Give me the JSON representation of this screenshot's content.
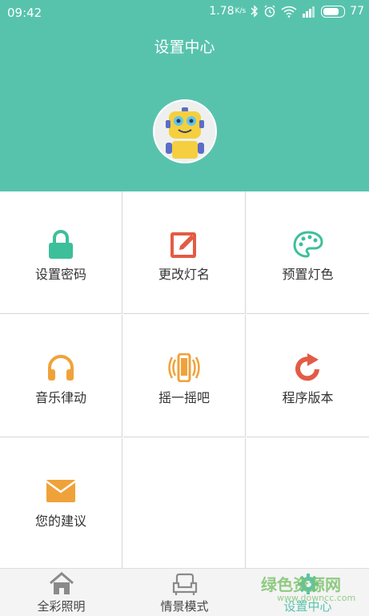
{
  "status": {
    "time": "09:42",
    "speed": "1.78",
    "speed_unit": "K/s",
    "battery": "77"
  },
  "header": {
    "title": "设置中心"
  },
  "grid": [
    {
      "label": "设置密码",
      "icon": "lock-icon",
      "color": "#3dbf9b"
    },
    {
      "label": "更改灯名",
      "icon": "edit-icon",
      "color": "#e35b45"
    },
    {
      "label": "预置灯色",
      "icon": "palette-icon",
      "color": "#3dbf9b"
    },
    {
      "label": "音乐律动",
      "icon": "headphones-icon",
      "color": "#f0a23a"
    },
    {
      "label": "摇一摇吧",
      "icon": "shake-phone-icon",
      "color": "#f0a23a"
    },
    {
      "label": "程序版本",
      "icon": "refresh-icon",
      "color": "#e35b45"
    },
    {
      "label": "您的建议",
      "icon": "mail-icon",
      "color": "#f0a23a"
    }
  ],
  "tabs": [
    {
      "label": "全彩照明",
      "icon": "home-icon"
    },
    {
      "label": "情景模式",
      "icon": "sofa-icon"
    },
    {
      "label": "设置中心",
      "icon": "gear-icon",
      "active": true
    }
  ],
  "watermark": {
    "text": "绿色资源网",
    "sub": "www.downcc.com"
  }
}
